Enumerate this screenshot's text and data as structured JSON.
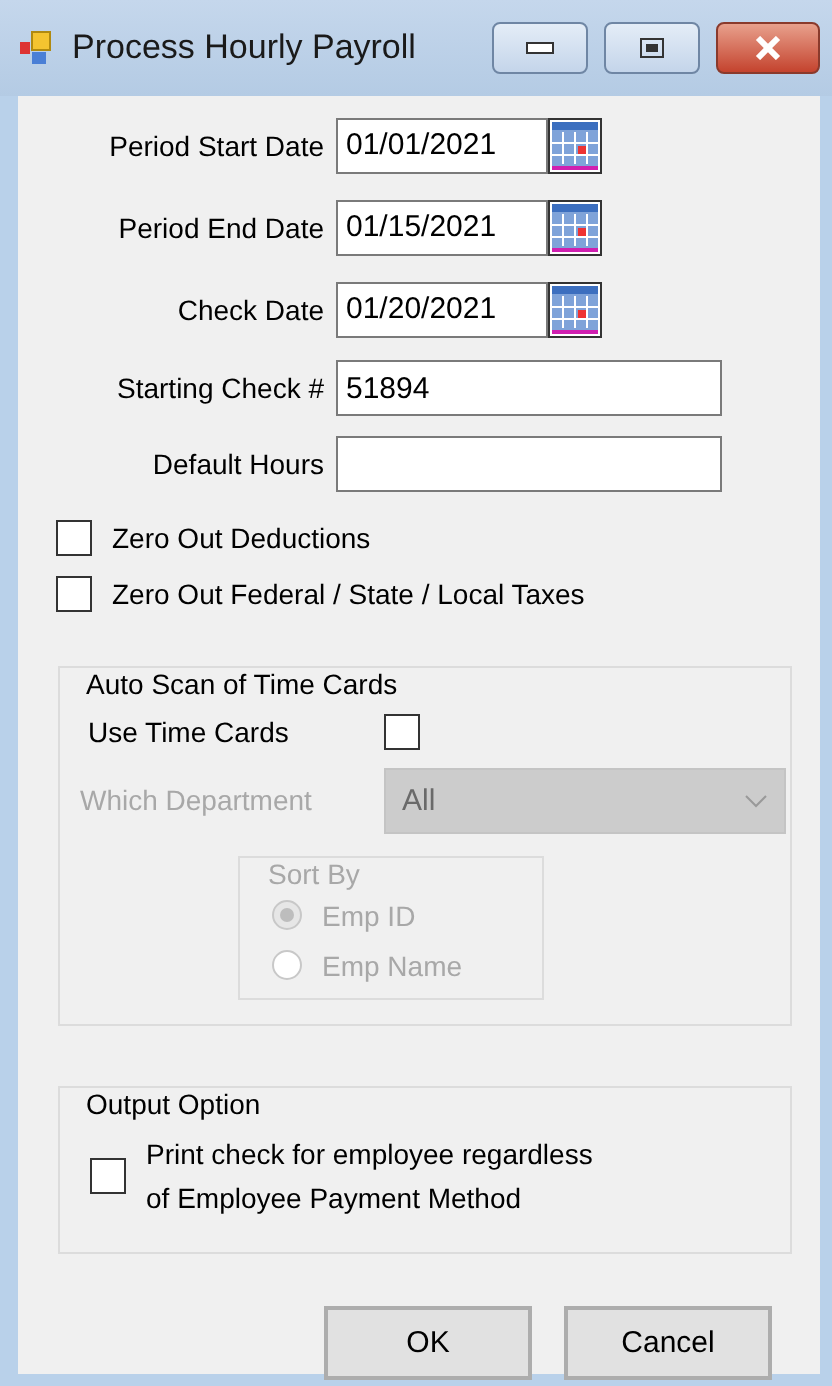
{
  "window": {
    "title": "Process Hourly Payroll"
  },
  "date_fields": [
    {
      "label": "Period Start Date",
      "value": "01/01/2021"
    },
    {
      "label": "Period End Date",
      "value": "01/15/2021"
    },
    {
      "label": "Check Date",
      "value": "01/20/2021"
    }
  ],
  "text_fields": [
    {
      "label": "Starting Check #",
      "value": "51894"
    },
    {
      "label": "Default Hours"
    }
  ],
  "options": [
    {
      "label": "Zero Out Deductions",
      "checked": false
    },
    {
      "label": "Zero Out Federal / State / Local Taxes",
      "checked": false
    }
  ],
  "auto_scan": {
    "title": "Auto Scan of Time Cards",
    "use_time_cards": {
      "label": "Use Time Cards",
      "checked": false
    },
    "department": {
      "label": "Which Department",
      "value": "All",
      "disabled": true
    },
    "sort_by": {
      "title": "Sort By",
      "disabled": true,
      "options": [
        {
          "label": "Emp ID",
          "selected": true
        },
        {
          "label": "Emp Name",
          "selected": false
        }
      ]
    }
  },
  "output_option": {
    "title": "Output Option",
    "label_lines": [
      "Print check for employee regardless",
      "of Employee Payment Method"
    ],
    "checked": false
  },
  "buttons": [
    "OK",
    "Cancel"
  ]
}
